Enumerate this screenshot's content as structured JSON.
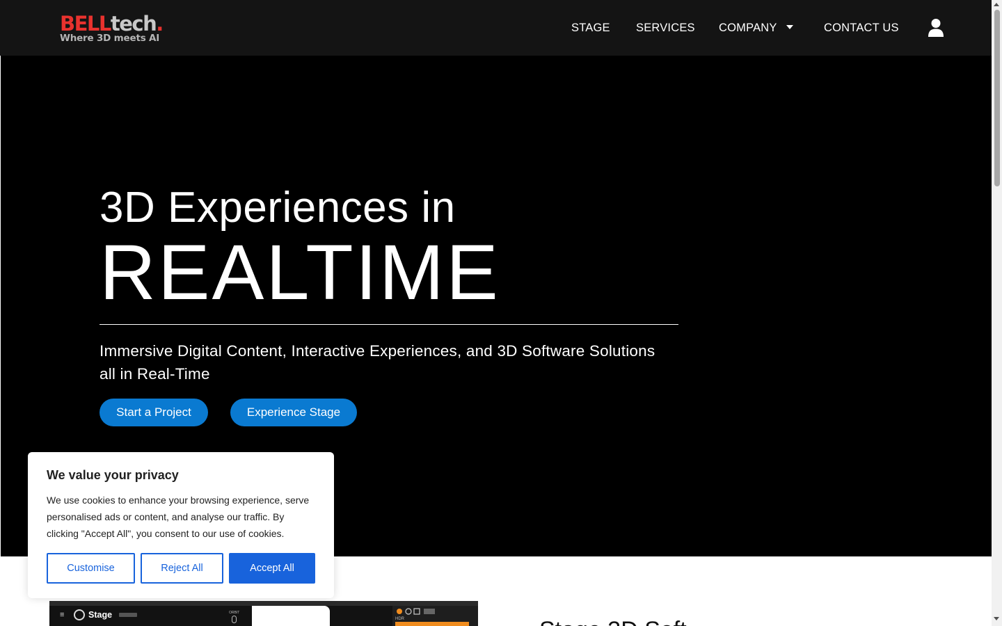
{
  "header": {
    "logo": {
      "brand_red": "BELL",
      "brand_grey": "tech",
      "brand_dot": ".",
      "tagline": "Where 3D meets AI"
    },
    "nav": [
      {
        "label": "STAGE"
      },
      {
        "label": "SERVICES"
      },
      {
        "label": "COMPANY",
        "has_dropdown": true
      },
      {
        "label": "CONTACT US"
      }
    ],
    "account_icon": "user-icon"
  },
  "hero": {
    "line1": "3D Experiences in",
    "line2": "REALTIME",
    "subtitle": "Immersive Digital Content, Interactive Experiences, and 3D Software Solutions all in Real-Time",
    "buttons": [
      {
        "label": "Start a Project"
      },
      {
        "label": "Experience Stage"
      }
    ]
  },
  "preview": {
    "app_name": "Stage",
    "menu_glyph": "≡",
    "orbit_label": "ORBIT",
    "hdr_label": "HDR"
  },
  "section": {
    "heading_partial": "Stage 3D Soft"
  },
  "cookie": {
    "title": "We value your privacy",
    "text": "We use cookies to enhance your browsing experience, serve personalised ads or content, and analyse our traffic. By clicking \"Accept All\", you consent to our use of cookies.",
    "buttons": {
      "customise": "Customise",
      "reject": "Reject All",
      "accept": "Accept All"
    }
  },
  "colors": {
    "header_bg": "#141414",
    "hero_bg": "#000000",
    "brand_red": "#e8322e",
    "pill_blue": "#0a7ad1",
    "cookie_blue": "#1863dc"
  }
}
